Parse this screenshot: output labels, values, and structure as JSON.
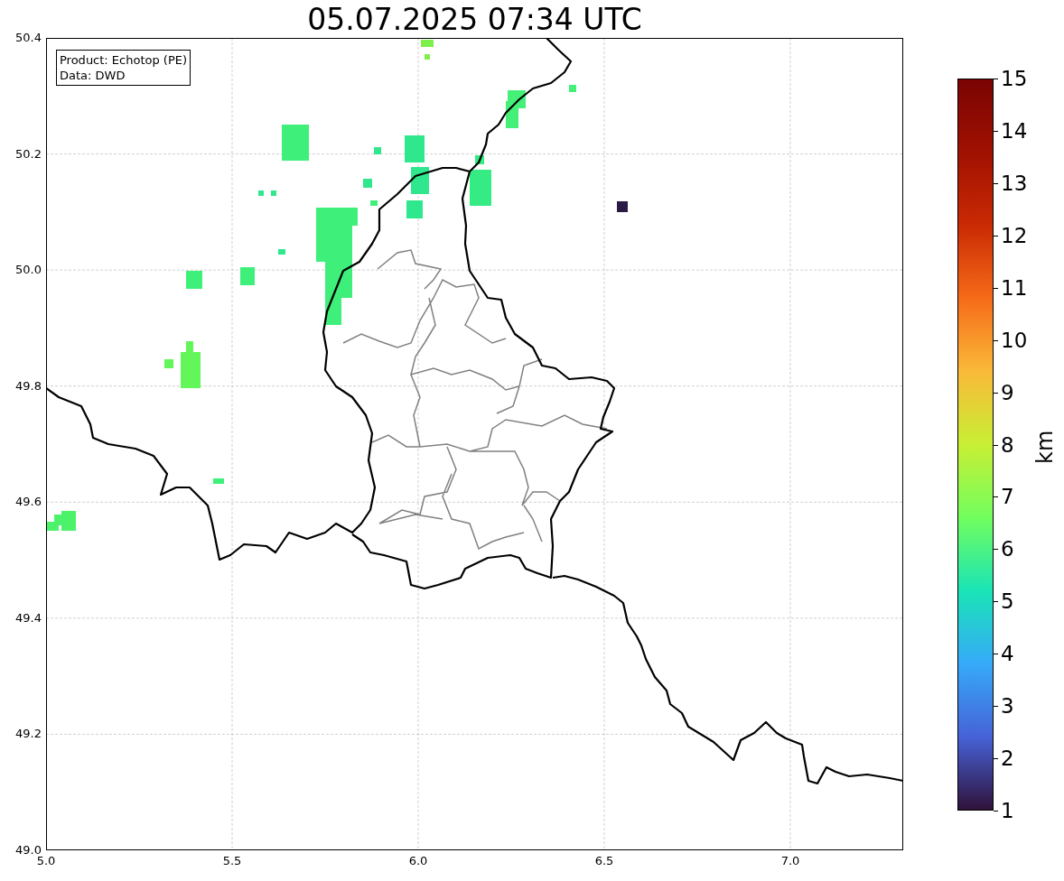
{
  "title": "05.07.2025 07:34 UTC",
  "legend": {
    "lines": [
      "Product: Echotop (PE)",
      "Data: DWD"
    ]
  },
  "map": {
    "x_ticks": [
      "5.0",
      "5.5",
      "6.0",
      "6.5",
      "7.0"
    ],
    "y_ticks": [
      "50.4",
      "50.2",
      "50.0",
      "49.8",
      "49.6",
      "49.4",
      "49.2",
      "49.0"
    ]
  },
  "colorbar": {
    "ticks": [
      "15",
      "14",
      "13",
      "12",
      "11",
      "10",
      "9",
      "8",
      "7",
      "6",
      "5",
      "4",
      "3",
      "2",
      "1"
    ],
    "label": "km"
  }
}
